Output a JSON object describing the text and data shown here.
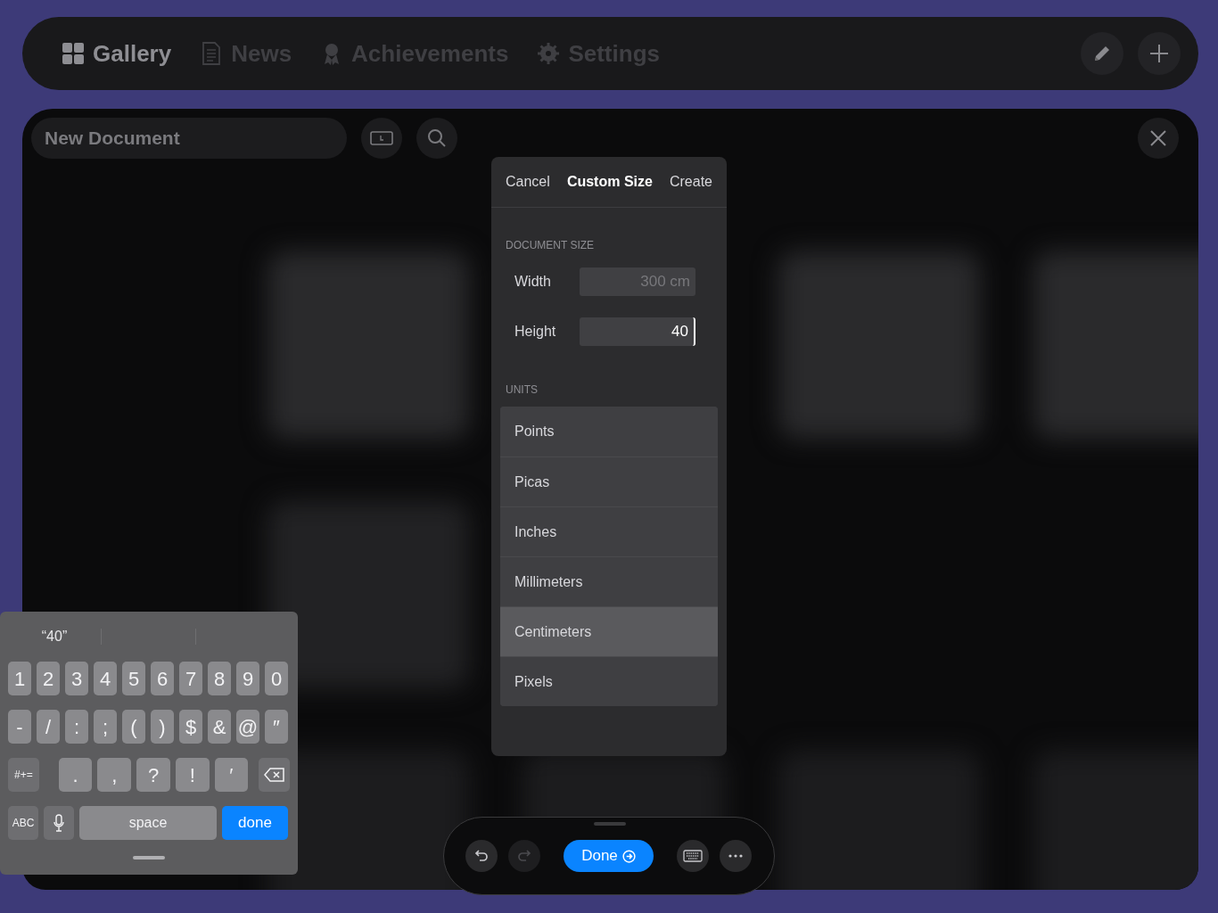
{
  "nav": {
    "items": [
      {
        "label": "Gallery",
        "selected": true
      },
      {
        "label": "News",
        "selected": false
      },
      {
        "label": "Achievements",
        "selected": false
      },
      {
        "label": "Settings",
        "selected": false
      }
    ]
  },
  "document": {
    "title": "New Document"
  },
  "dialog": {
    "cancel": "Cancel",
    "title": "Custom Size",
    "create": "Create",
    "size_heading": "DOCUMENT SIZE",
    "fields": [
      {
        "label": "Width",
        "placeholder": "300 cm",
        "focused": false
      },
      {
        "label": "Height",
        "value": "40",
        "focused": true
      }
    ],
    "units_heading": "UNITS",
    "units": [
      {
        "label": "Points",
        "selected": false
      },
      {
        "label": "Picas",
        "selected": false
      },
      {
        "label": "Inches",
        "selected": false
      },
      {
        "label": "Millimeters",
        "selected": false
      },
      {
        "label": "Centimeters",
        "selected": true
      },
      {
        "label": "Pixels",
        "selected": false
      }
    ]
  },
  "keyboard": {
    "suggestion": "“40”",
    "key_groups": [
      {
        "keys": [
          {
            "kind": "char",
            "label": "1"
          },
          {
            "kind": "char",
            "label": "2"
          },
          {
            "kind": "char",
            "label": "3"
          },
          {
            "kind": "char",
            "label": "4"
          },
          {
            "kind": "char",
            "label": "5"
          },
          {
            "kind": "char",
            "label": "6"
          },
          {
            "kind": "char",
            "label": "7"
          },
          {
            "kind": "char",
            "label": "8"
          },
          {
            "kind": "char",
            "label": "9"
          },
          {
            "kind": "char",
            "label": "0"
          }
        ]
      },
      {
        "keys": [
          {
            "kind": "char",
            "label": "-"
          },
          {
            "kind": "char",
            "label": "/"
          },
          {
            "kind": "char",
            "label": ":"
          },
          {
            "kind": "char",
            "label": ";"
          },
          {
            "kind": "char",
            "label": "("
          },
          {
            "kind": "char",
            "label": ")"
          },
          {
            "kind": "char",
            "label": "$"
          },
          {
            "kind": "char",
            "label": "&"
          },
          {
            "kind": "char",
            "label": "@"
          },
          {
            "kind": "char",
            "label": "″"
          }
        ]
      },
      {
        "keys": [
          {
            "kind": "mode",
            "label": "#+="
          },
          {
            "kind": "char",
            "label": "."
          },
          {
            "kind": "char",
            "label": ","
          },
          {
            "kind": "char",
            "label": "?"
          },
          {
            "kind": "char",
            "label": "!"
          },
          {
            "kind": "char",
            "label": "′"
          },
          {
            "kind": "delete"
          }
        ]
      },
      {
        "keys": [
          {
            "kind": "mode",
            "label": "ABC"
          },
          {
            "kind": "mic"
          },
          {
            "kind": "space",
            "label": "space"
          },
          {
            "kind": "done",
            "label": "done"
          }
        ]
      }
    ]
  },
  "toolbar": {
    "done": "Done"
  }
}
